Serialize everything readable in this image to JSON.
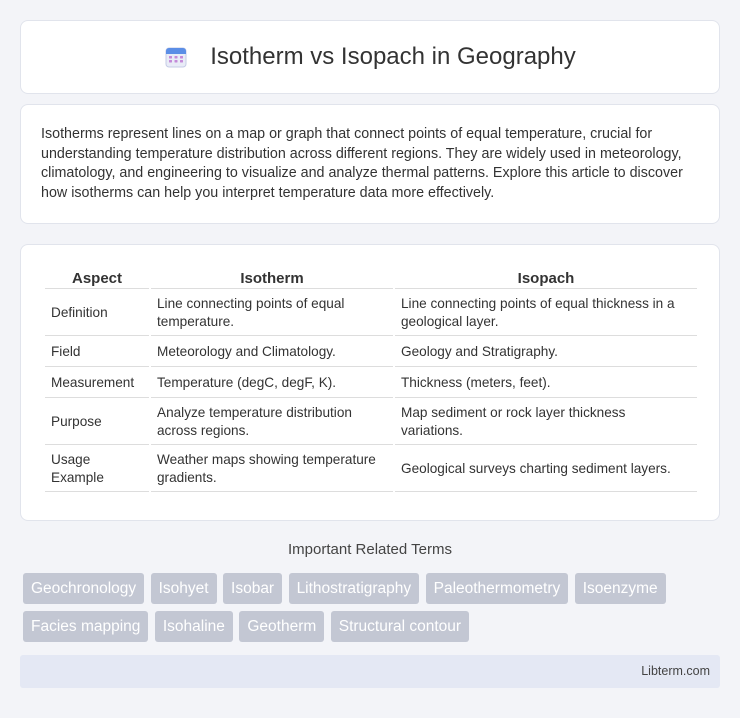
{
  "header": {
    "title": "Isotherm vs Isopach in Geography",
    "icon": "calendar-icon"
  },
  "intro": {
    "text": "Isotherms represent lines on a map or graph that connect points of equal temperature, crucial for understanding temperature distribution across different regions. They are widely used in meteorology, climatology, and engineering to visualize and analyze thermal patterns. Explore this article to discover how isotherms can help you interpret temperature data more effectively."
  },
  "table": {
    "headers": [
      "Aspect",
      "Isotherm",
      "Isopach"
    ],
    "rows": [
      [
        "Definition",
        "Line connecting points of equal temperature.",
        "Line connecting points of equal thickness in a geological layer."
      ],
      [
        "Field",
        "Meteorology and Climatology.",
        "Geology and Stratigraphy."
      ],
      [
        "Measurement",
        "Temperature (degC, degF, K).",
        "Thickness (meters, feet)."
      ],
      [
        "Purpose",
        "Analyze temperature distribution across regions.",
        "Map sediment or rock layer thickness variations."
      ],
      [
        "Usage Example",
        "Weather maps showing temperature gradients.",
        "Geological surveys charting sediment layers."
      ]
    ]
  },
  "related": {
    "title": "Important Related Terms",
    "tags": [
      "Geochronology",
      "Isohyet",
      "Isobar",
      "Lithostratigraphy",
      "Paleothermometry",
      "Isoenzyme",
      "Facies mapping",
      "Isohaline",
      "Geotherm",
      "Structural contour"
    ]
  },
  "footer": {
    "brand": "Libterm.com"
  }
}
